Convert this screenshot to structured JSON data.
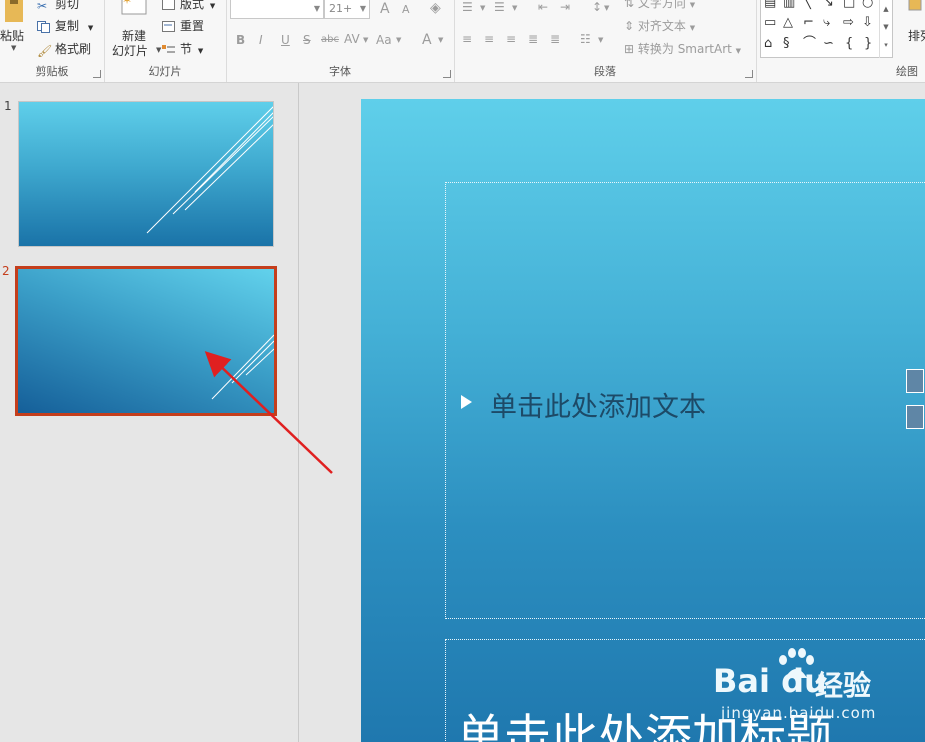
{
  "ribbon": {
    "clipboard": {
      "paste_label": "粘贴",
      "cut_label": "剪切",
      "copy_label": "复制",
      "format_painter_label": "格式刷",
      "group_label": "剪贴板"
    },
    "slides": {
      "new_slide_label_1": "新建",
      "new_slide_label_2": "幻灯片",
      "layout_label": "版式",
      "reset_label": "重置",
      "section_label": "节",
      "group_label": "幻灯片"
    },
    "font": {
      "font_size_value": "21+",
      "bold": "B",
      "italic": "I",
      "underline": "U",
      "strikethrough": "S",
      "shadow": "abc",
      "spacing": "AV",
      "change_case": "Aa",
      "font_color": "A",
      "grow_font": "A",
      "shrink_font": "A",
      "group_label": "字体"
    },
    "paragraph": {
      "text_direction_label": "文字方向",
      "align_text_label": "对齐文本",
      "convert_smartart_label": "转换为 SmartArt",
      "group_label": "段落"
    },
    "drawing": {
      "arrange_label": "排列",
      "group_label": "绘图"
    }
  },
  "thumbnails": [
    {
      "number": "1",
      "selected": false
    },
    {
      "number": "2",
      "selected": true
    }
  ],
  "slide": {
    "body_placeholder": "单击此处添加文本",
    "title_placeholder": "单击此处添加标题"
  },
  "watermark": {
    "brand": "Bai  du",
    "cn": "经验",
    "url": "jingyan.baidu.com"
  },
  "colors": {
    "selection_border": "#c43e1c",
    "annotation_arrow": "#e02020",
    "slide_top": "#5fcfea",
    "slide_bottom": "#1e76ad"
  }
}
